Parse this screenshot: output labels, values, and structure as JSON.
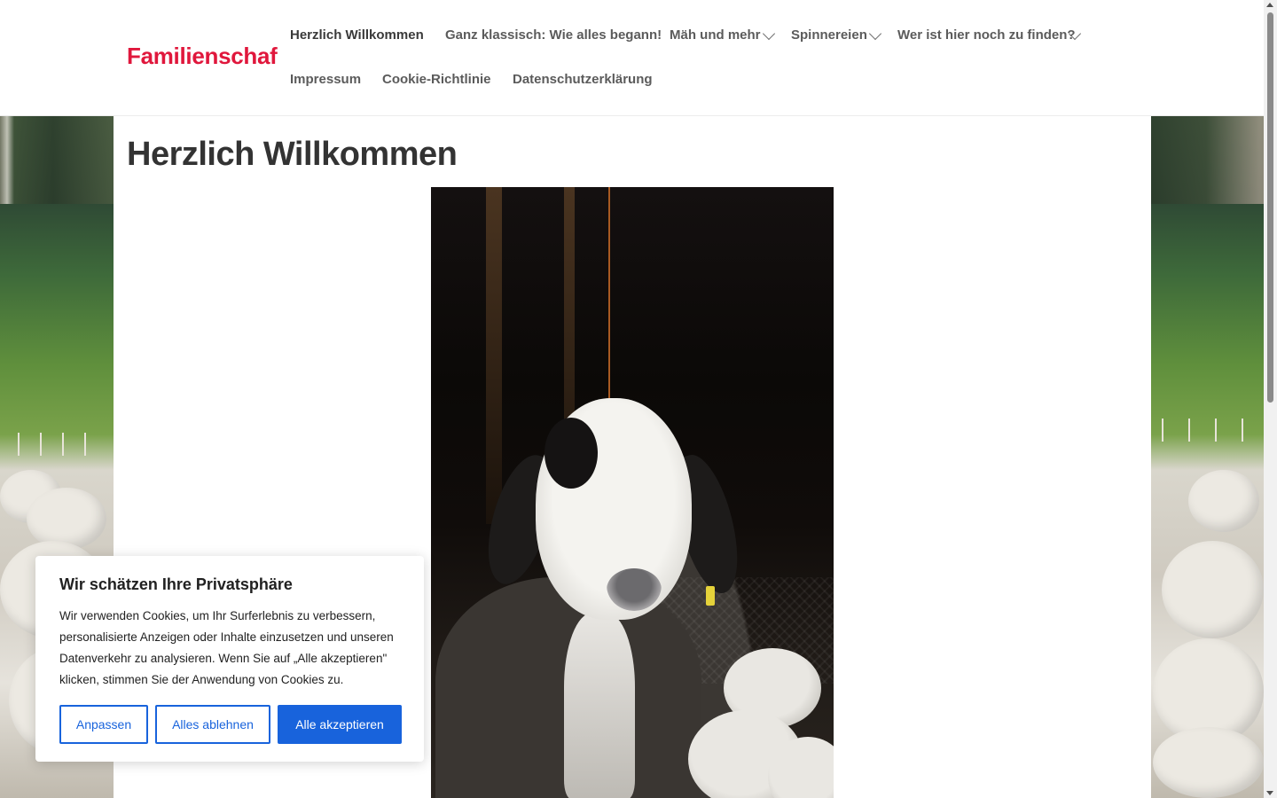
{
  "site": {
    "title": "Familienschaf"
  },
  "nav": {
    "items": [
      {
        "label": "Herzlich Willkommen",
        "active": true,
        "has_submenu": false
      },
      {
        "label": "Ganz klassisch: Wie alles begann!",
        "active": false,
        "has_submenu": false
      },
      {
        "label": "Mäh und mehr",
        "active": false,
        "has_submenu": true
      },
      {
        "label": "Spinnereien",
        "active": false,
        "has_submenu": true
      },
      {
        "label": "Wer ist hier noch zu finden?",
        "active": false,
        "has_submenu": true
      },
      {
        "label": "Impressum",
        "active": false,
        "has_submenu": false
      },
      {
        "label": "Cookie-Richtlinie",
        "active": false,
        "has_submenu": false
      },
      {
        "label": "Datenschutzerklärung",
        "active": false,
        "has_submenu": false
      }
    ],
    "submenu_icon": "chevron-down-icon"
  },
  "main": {
    "title": "Herzlich Willkommen",
    "image": "sheep-portrait-photo"
  },
  "cookie_banner": {
    "title": "Wir schätzen Ihre Privatsphäre",
    "text": "Wir verwenden Cookies, um Ihr Surferlebnis zu verbessern, personalisierte Anzeigen oder Inhalte einzusetzen und unseren Datenverkehr zu analysieren. Wenn Sie auf „Alle akzeptieren\" klicken, stimmen Sie der Anwendung von Cookies zu.",
    "buttons": {
      "customize": "Anpassen",
      "reject": "Alles ablehnen",
      "accept": "Alle akzeptieren"
    }
  },
  "colors": {
    "brand": "#e0173c",
    "button_blue": "#1863dc",
    "text_dark": "#333333",
    "nav_text": "#5b5b5b"
  }
}
